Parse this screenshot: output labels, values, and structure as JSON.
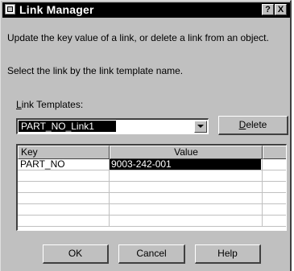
{
  "title": "Link Manager",
  "titlebar_buttons": {
    "help": "?",
    "close": "X"
  },
  "description_line1": "Update the key value of a link, or delete a link from an object.",
  "description_line2": "Select the link by the link template name.",
  "link_templates": {
    "label_prefix": "L",
    "label_rest": "ink Templates:",
    "selected": "PART_NO_Link1"
  },
  "delete_button": {
    "mnemonic": "D",
    "rest": "elete"
  },
  "table": {
    "headers": [
      "Key",
      "Value"
    ],
    "rows": [
      {
        "key": "PART_NO",
        "value": "9003-242-001"
      }
    ]
  },
  "buttons": {
    "ok": "OK",
    "cancel": "Cancel",
    "help": "Help"
  }
}
